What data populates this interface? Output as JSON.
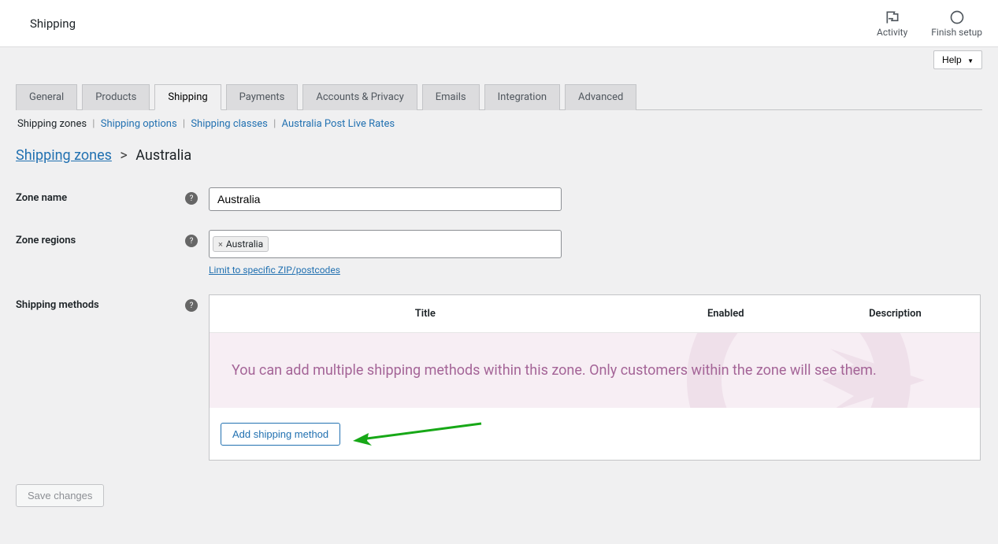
{
  "header": {
    "title": "Shipping",
    "actions": {
      "activity": "Activity",
      "finish_setup": "Finish setup"
    }
  },
  "help_label": "Help",
  "tabs": [
    {
      "label": "General",
      "active": false
    },
    {
      "label": "Products",
      "active": false
    },
    {
      "label": "Shipping",
      "active": true
    },
    {
      "label": "Payments",
      "active": false
    },
    {
      "label": "Accounts & Privacy",
      "active": false
    },
    {
      "label": "Emails",
      "active": false
    },
    {
      "label": "Integration",
      "active": false
    },
    {
      "label": "Advanced",
      "active": false
    }
  ],
  "subnav": {
    "zones": "Shipping zones",
    "options": "Shipping options",
    "classes": "Shipping classes",
    "aus_post": "Australia Post Live Rates"
  },
  "breadcrumb": {
    "root": "Shipping zones",
    "current": "Australia"
  },
  "form": {
    "zone_name_label": "Zone name",
    "zone_name_value": "Australia",
    "zone_regions_label": "Zone regions",
    "region_tag": "Australia",
    "limit_link": "Limit to specific ZIP/postcodes",
    "shipping_methods_label": "Shipping methods"
  },
  "methods_table": {
    "col_title": "Title",
    "col_enabled": "Enabled",
    "col_description": "Description",
    "empty_text": "You can add multiple shipping methods within this zone. Only customers within the zone will see them.",
    "add_button": "Add shipping method"
  },
  "save_button": "Save changes"
}
